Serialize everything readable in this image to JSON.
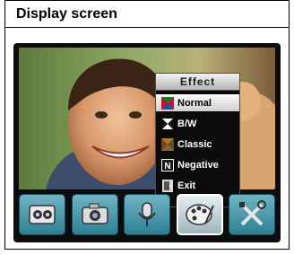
{
  "header": {
    "title": "Display screen"
  },
  "effect_menu": {
    "title": "Effect",
    "items": [
      {
        "label": "Normal",
        "icon": "normal-effect-icon",
        "selected": true
      },
      {
        "label": "B/W",
        "icon": "bw-effect-icon",
        "selected": false
      },
      {
        "label": "Classic",
        "icon": "classic-effect-icon",
        "selected": false
      },
      {
        "label": "Negative",
        "icon": "negative-effect-icon",
        "selected": false
      },
      {
        "label": "Exit",
        "icon": "exit-icon",
        "selected": false
      }
    ]
  },
  "toolbar": {
    "buttons": [
      {
        "icon": "video-camera-icon",
        "active": false
      },
      {
        "icon": "photo-camera-icon",
        "active": false
      },
      {
        "icon": "microphone-icon",
        "active": false
      },
      {
        "icon": "palette-icon",
        "active": true
      },
      {
        "icon": "tools-icon",
        "active": false
      }
    ]
  },
  "colors": {
    "accent": "#2f7f94",
    "menu_bg": "#0a0a0a"
  }
}
